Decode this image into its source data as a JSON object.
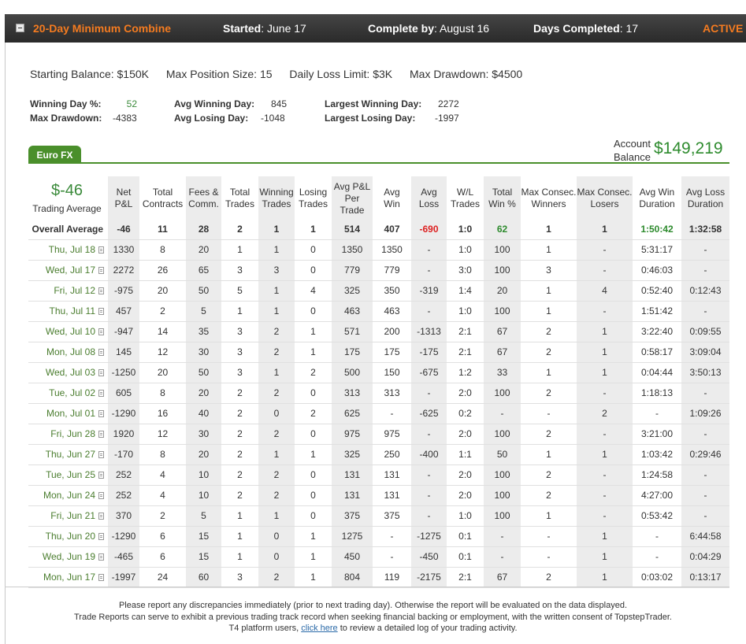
{
  "header": {
    "title": "20-Day Minimum Combine",
    "started_label": "Started",
    "started_value": ": June 17",
    "complete_label": "Complete by",
    "complete_value": ": August 16",
    "days_label": "Days Completed",
    "days_value": ": 17",
    "status": "ACTIVE"
  },
  "summary": {
    "starting_balance": "Starting Balance: $150K",
    "max_position": "Max Position Size: 15",
    "daily_loss": "Daily Loss Limit: $3K",
    "max_drawdown": "Max Drawdown: $4500"
  },
  "stats": {
    "winning_day_pct_label": "Winning Day %:",
    "winning_day_pct": "52",
    "max_drawdown_label": "Max Drawdown:",
    "max_drawdown": "-4383",
    "avg_winning_day_label": "Avg Winning Day:",
    "avg_winning_day": "845",
    "avg_losing_day_label": "Avg Losing Day:",
    "avg_losing_day": "-1048",
    "largest_winning_day_label": "Largest Winning Day:",
    "largest_winning_day": "2272",
    "largest_losing_day_label": "Largest Losing Day:",
    "largest_losing_day": "-1997"
  },
  "tab": {
    "label": "Euro FX"
  },
  "account": {
    "label_line1": "Account",
    "label_line2": "Balance",
    "value": "$149,219"
  },
  "trading_average": {
    "value": "$-46",
    "label": "Trading Average"
  },
  "columns": [
    "Net P&L",
    "Total Contracts",
    "Fees & Comm.",
    "Total Trades",
    "Winning Trades",
    "Losing Trades",
    "Avg P&L Per Trade",
    "Avg Win",
    "Avg Loss",
    "W/L Trades",
    "Total Win %",
    "Max Consec. Winners",
    "Max Consec. Losers",
    "Avg Win Duration",
    "Avg Loss Duration"
  ],
  "overall": {
    "label": "Overall Average",
    "cells": [
      "-46",
      "11",
      "28",
      "2",
      "1",
      "1",
      "514",
      "407",
      "-690",
      "1:0",
      "62",
      "1",
      "1",
      "1:50:42",
      "1:32:58"
    ]
  },
  "rows": [
    {
      "date": "Thu, Jul 18",
      "cells": [
        "1330",
        "8",
        "20",
        "1",
        "1",
        "0",
        "1350",
        "1350",
        "-",
        "1:0",
        "100",
        "1",
        "-",
        "5:31:17",
        "-"
      ]
    },
    {
      "date": "Wed, Jul 17",
      "cells": [
        "2272",
        "26",
        "65",
        "3",
        "3",
        "0",
        "779",
        "779",
        "-",
        "3:0",
        "100",
        "3",
        "-",
        "0:46:03",
        "-"
      ]
    },
    {
      "date": "Fri, Jul 12",
      "cells": [
        "-975",
        "20",
        "50",
        "5",
        "1",
        "4",
        "325",
        "350",
        "-319",
        "1:4",
        "20",
        "1",
        "4",
        "0:52:40",
        "0:12:43"
      ]
    },
    {
      "date": "Thu, Jul 11",
      "cells": [
        "457",
        "2",
        "5",
        "1",
        "1",
        "0",
        "463",
        "463",
        "-",
        "1:0",
        "100",
        "1",
        "-",
        "1:51:42",
        "-"
      ]
    },
    {
      "date": "Wed, Jul 10",
      "cells": [
        "-947",
        "14",
        "35",
        "3",
        "2",
        "1",
        "571",
        "200",
        "-1313",
        "2:1",
        "67",
        "2",
        "1",
        "3:22:40",
        "0:09:55"
      ]
    },
    {
      "date": "Mon, Jul 08",
      "cells": [
        "145",
        "12",
        "30",
        "3",
        "2",
        "1",
        "175",
        "175",
        "-175",
        "2:1",
        "67",
        "2",
        "1",
        "0:58:17",
        "3:09:04"
      ]
    },
    {
      "date": "Wed, Jul 03",
      "cells": [
        "-1250",
        "20",
        "50",
        "3",
        "1",
        "2",
        "500",
        "150",
        "-675",
        "1:2",
        "33",
        "1",
        "1",
        "0:04:44",
        "3:50:13"
      ]
    },
    {
      "date": "Tue, Jul 02",
      "cells": [
        "605",
        "8",
        "20",
        "2",
        "2",
        "0",
        "313",
        "313",
        "-",
        "2:0",
        "100",
        "2",
        "-",
        "1:18:13",
        "-"
      ]
    },
    {
      "date": "Mon, Jul 01",
      "cells": [
        "-1290",
        "16",
        "40",
        "2",
        "0",
        "2",
        "625",
        "-",
        "-625",
        "0:2",
        "-",
        "-",
        "2",
        "-",
        "1:09:26"
      ]
    },
    {
      "date": "Fri, Jun 28",
      "cells": [
        "1920",
        "12",
        "30",
        "2",
        "2",
        "0",
        "975",
        "975",
        "-",
        "2:0",
        "100",
        "2",
        "-",
        "3:21:00",
        "-"
      ]
    },
    {
      "date": "Thu, Jun 27",
      "cells": [
        "-170",
        "8",
        "20",
        "2",
        "1",
        "1",
        "325",
        "250",
        "-400",
        "1:1",
        "50",
        "1",
        "1",
        "1:03:42",
        "0:29:46"
      ]
    },
    {
      "date": "Tue, Jun 25",
      "cells": [
        "252",
        "4",
        "10",
        "2",
        "2",
        "0",
        "131",
        "131",
        "-",
        "2:0",
        "100",
        "2",
        "-",
        "1:24:58",
        "-"
      ]
    },
    {
      "date": "Mon, Jun 24",
      "cells": [
        "252",
        "4",
        "10",
        "2",
        "2",
        "0",
        "131",
        "131",
        "-",
        "2:0",
        "100",
        "2",
        "-",
        "4:27:00",
        "-"
      ]
    },
    {
      "date": "Fri, Jun 21",
      "cells": [
        "370",
        "2",
        "5",
        "1",
        "1",
        "0",
        "375",
        "375",
        "-",
        "1:0",
        "100",
        "1",
        "-",
        "0:53:42",
        "-"
      ]
    },
    {
      "date": "Thu, Jun 20",
      "cells": [
        "-1290",
        "6",
        "15",
        "1",
        "0",
        "1",
        "1275",
        "-",
        "-1275",
        "0:1",
        "-",
        "-",
        "1",
        "-",
        "6:44:58"
      ]
    },
    {
      "date": "Wed, Jun 19",
      "cells": [
        "-465",
        "6",
        "15",
        "1",
        "0",
        "1",
        "450",
        "-",
        "-450",
        "0:1",
        "-",
        "-",
        "1",
        "-",
        "0:04:29"
      ]
    },
    {
      "date": "Mon, Jun 17",
      "cells": [
        "-1997",
        "24",
        "60",
        "3",
        "2",
        "1",
        "804",
        "119",
        "-2175",
        "2:1",
        "67",
        "2",
        "1",
        "0:03:02",
        "0:13:17"
      ]
    }
  ],
  "footer": {
    "line1": "Please report any discrepancies immediately (prior to next trading day). Otherwise the report will be evaluated on the data displayed.",
    "line2": "Trade Reports can serve to exhibit a previous trading track record when seeking financial backing or employment, with the written consent of TopstepTrader.",
    "line3_pre": "T4 platform users, ",
    "line3_link": "click here",
    "line3_post": " to review a detailed log of your trading activity."
  },
  "colors": {
    "accent": "#f47b20",
    "green": "#4a8f2b",
    "negative": "#dd2222"
  }
}
